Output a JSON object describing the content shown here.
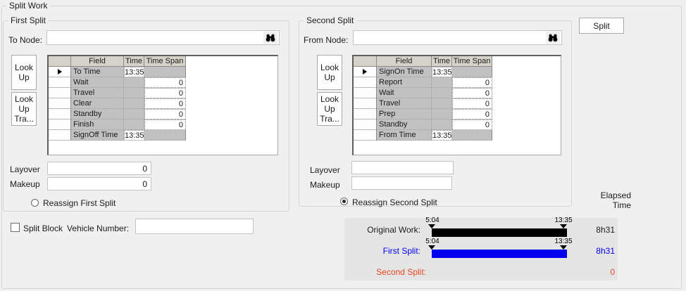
{
  "colors": {
    "background": "#f0f0f0",
    "chart_panel_background": "#e5e5e5",
    "grid_header_bg": "#d5d2ca",
    "grid_field_bg": "#c1c1c1",
    "original_work_bar": "#000000",
    "first_split_accent": "#0000ee",
    "second_split_accent": "#e2461f"
  },
  "group_title": "Split Work",
  "split_button_label": "Split",
  "first_split": {
    "title": "First Split",
    "node_label": "To Node:",
    "node_value": "",
    "lookup_button_label": "Look Up",
    "lookup_tra_button_label": "Look Up Tra...",
    "grid": {
      "headers": [
        "Field",
        "Time",
        "Time Span"
      ],
      "rows": [
        {
          "field": "To Time",
          "time": "13:35",
          "span": "",
          "selected": true
        },
        {
          "field": "Wait",
          "time": "",
          "span": "0",
          "selected": false
        },
        {
          "field": "Travel",
          "time": "",
          "span": "0",
          "selected": false
        },
        {
          "field": "Clear",
          "time": "",
          "span": "0",
          "selected": false
        },
        {
          "field": "Standby",
          "time": "",
          "span": "0",
          "selected": false
        },
        {
          "field": "Finish",
          "time": "",
          "span": "0",
          "selected": false
        },
        {
          "field": "SignOff Time",
          "time": "13:35",
          "span": "",
          "selected": false
        }
      ]
    },
    "layover_label": "Layover",
    "layover_value": "0",
    "makeup_label": "Makeup",
    "makeup_value": "0",
    "radio_label": "Reassign First Split",
    "radio_selected": false
  },
  "second_split": {
    "title": "Second Split",
    "node_label": "From Node:",
    "node_value": "",
    "lookup_button_label": "Look Up",
    "lookup_tra_button_label": "Look Up Tra...",
    "grid": {
      "headers": [
        "Field",
        "Time",
        "Time Span"
      ],
      "rows": [
        {
          "field": "SignOn Time",
          "time": "13:35",
          "span": "",
          "selected": true
        },
        {
          "field": "Report",
          "time": "",
          "span": "0",
          "selected": false
        },
        {
          "field": "Wait",
          "time": "",
          "span": "0",
          "selected": false
        },
        {
          "field": "Travel",
          "time": "",
          "span": "0",
          "selected": false
        },
        {
          "field": "Prep",
          "time": "",
          "span": "0",
          "selected": false
        },
        {
          "field": "Standby",
          "time": "",
          "span": "0",
          "selected": false
        },
        {
          "field": "From Time",
          "time": "13:35",
          "span": "",
          "selected": false
        }
      ]
    },
    "layover_label": "Layover",
    "layover_value": "",
    "makeup_label": "Makeup",
    "makeup_value": "",
    "radio_label": "Reassign Second Split",
    "radio_selected": true
  },
  "split_block": {
    "checkbox_label": "Split Block",
    "checked": false,
    "vehicle_label": "Vehicle Number:",
    "vehicle_value": ""
  },
  "elapsed_header": {
    "line1": "Elapsed",
    "line2": "Time"
  },
  "chart_data": {
    "type": "bar",
    "orientation": "horizontal-timeline",
    "time_axis": {
      "start": "5:04",
      "end": "13:35"
    },
    "rows": [
      {
        "label": "Original Work:",
        "start": "5:04",
        "end": "13:35",
        "elapsed": "8h31",
        "bar_color": "#000000",
        "has_bar": true
      },
      {
        "label": "First Split:",
        "start": "5:04",
        "end": "13:35",
        "elapsed": "8h31",
        "bar_color": "#0000ee",
        "has_bar": true
      },
      {
        "label": "Second Split:",
        "start": "",
        "end": "",
        "elapsed": "0",
        "bar_color": "",
        "has_bar": false
      }
    ]
  }
}
